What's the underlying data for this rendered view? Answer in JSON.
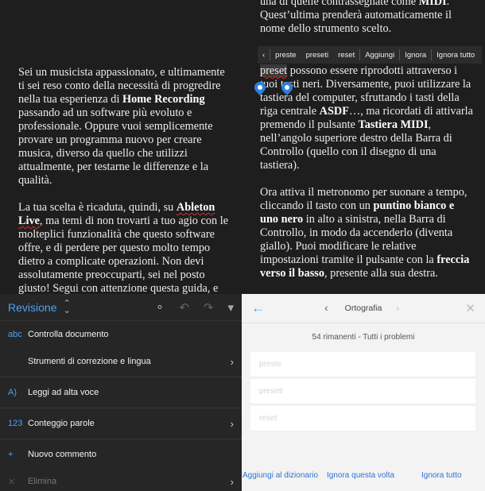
{
  "left_doc": {
    "p1": {
      "t1": "Sei un musicista appassionato, e ultimamente ti sei reso conto della necessità di progredire nella tua esperienza di ",
      "b1": "Home Recording",
      "t2": " passando ad un software più evoluto e professionale. Oppure vuoi semplicemente provare un programma nuovo per creare musica, diverso da quello che utilizzi attualmente, per testarne le differenze e la qualità."
    },
    "p2": {
      "t1": "La tua scelta è ricaduta, quindi, su ",
      "b1": "Ableton Live",
      "t2": ", ma temi di non trovarti a tuo agio con le molteplici funzionalità che questo software offre, e di perdere per questo molto tempo dietro a complicate operazioni. Non devi assolutamente preoccuparti, sei nel posto giusto! Segui con attenzione questa guida, e"
    }
  },
  "revisione": {
    "title": "Revisione",
    "items": [
      {
        "icon": "abc",
        "label": "Controlla documento"
      },
      {
        "label": "Strumenti di correzione e lingua",
        "arrow": "›"
      },
      {
        "icon": "A)",
        "label": "Leggi ad alta voce"
      },
      {
        "icon": "123",
        "label": "Conteggio parole",
        "arrow": "›"
      },
      {
        "icon": "+",
        "label": "Nuovo commento"
      },
      {
        "icon": "✕",
        "label": "Elimina",
        "arrow": "›"
      }
    ]
  },
  "right_doc": {
    "top": {
      "t1": "una di quelle contrassegnate come ",
      "b1": "MIDI",
      "t2": ". Quest’ultima prenderà automaticamente il nome dello strumento scelto."
    },
    "p2": {
      "w1": "preset",
      "t1": " possono essere riprodotti attraverso i tuoi tasti neri. Diversamente, puoi utilizzare la tastiera del computer, sfruttando i tasti della riga centrale ",
      "b1": "ASDF",
      "t2": "…, ma ricordati di attivarla premendo il pulsante ",
      "b2": "Tastiera MIDI",
      "t3": ", nell’angolo superiore destro della Barra di Controllo (quello con il disegno di una tastiera)."
    },
    "p3": {
      "t1": "Ora attiva il metronomo per suonare a tempo, cliccando il tasto con un ",
      "b1": "puntino bianco e uno nero",
      "t2": " in alto a sinistra, nella Barra di Controllo, in modo da accenderlo (diventa giallo). Puoi modificare le relative impostazioni tramite il pulsante con la ",
      "b2": "freccia verso il basso",
      "t3": ", presente alla sua destra."
    }
  },
  "popup": {
    "back": "‹",
    "suggestions": [
      "preste",
      "preseti",
      "reset"
    ],
    "aggiungi": "Aggiungi",
    "ignora": "Ignora",
    "ignora_tutto": "Ignora tutto"
  },
  "ortografia": {
    "title": "Ortografia",
    "count": "54 rimanenti - Tutti i problemi",
    "suggestions": [
      "preste",
      "preseti",
      "reset"
    ],
    "actions": {
      "add": "Aggiungi al dizionario",
      "ignore_once": "Ignora questa volta",
      "ignore_all": "Ignora tutto"
    }
  }
}
